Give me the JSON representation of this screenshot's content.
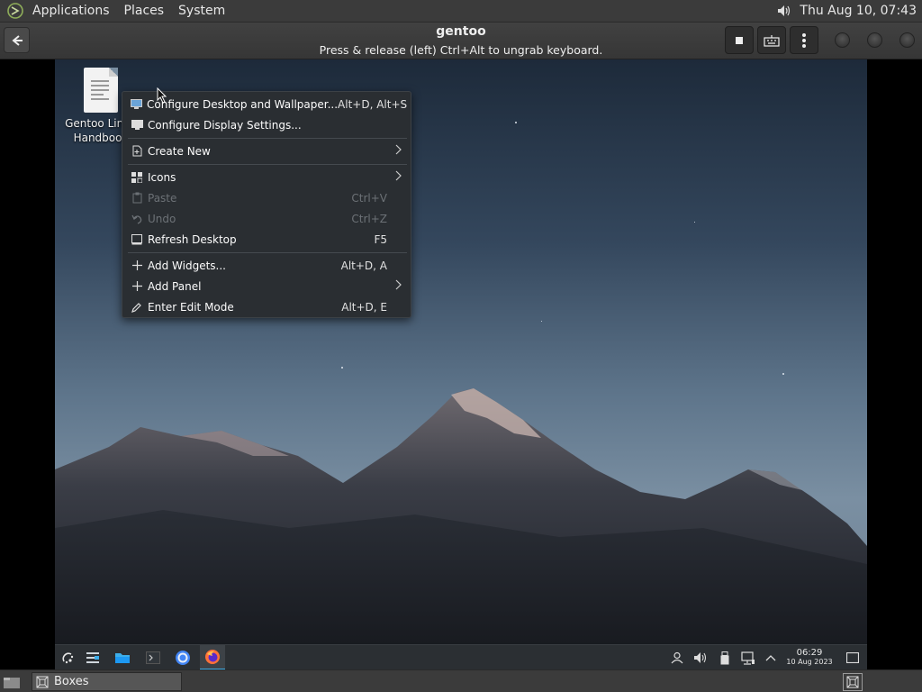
{
  "top_panel": {
    "menus": [
      "Applications",
      "Places",
      "System"
    ],
    "clock": "Thu Aug 10, 07:43"
  },
  "header": {
    "title": "gentoo",
    "subtitle": "Press & release (left) Ctrl+Alt to ungrab keyboard."
  },
  "desktop": {
    "icon_label_line1": "Gentoo Linux",
    "icon_label_line2": "Handbook"
  },
  "context_menu": {
    "items": [
      {
        "label": "Configure Desktop and Wallpaper...",
        "shortcut": "Alt+D, Alt+S",
        "icon": "wallpaper-icon",
        "enabled": true
      },
      {
        "label": "Configure Display Settings...",
        "shortcut": "",
        "icon": "display-icon",
        "enabled": true
      },
      {
        "label": "Create New",
        "shortcut": "",
        "icon": "new-document-icon",
        "enabled": true,
        "submenu": true
      },
      {
        "label": "Icons",
        "shortcut": "",
        "icon": "icons-grid-icon",
        "enabled": true,
        "submenu": true
      },
      {
        "label": "Paste",
        "shortcut": "Ctrl+V",
        "icon": "paste-icon",
        "enabled": false
      },
      {
        "label": "Undo",
        "shortcut": "Ctrl+Z",
        "icon": "undo-icon",
        "enabled": false
      },
      {
        "label": "Refresh Desktop",
        "shortcut": "F5",
        "icon": "refresh-icon",
        "enabled": true
      },
      {
        "label": "Add Widgets...",
        "shortcut": "Alt+D, A",
        "icon": "plus-icon",
        "enabled": true
      },
      {
        "label": "Add Panel",
        "shortcut": "",
        "icon": "plus-icon",
        "enabled": true,
        "submenu": true
      },
      {
        "label": "Enter Edit Mode",
        "shortcut": "Alt+D, E",
        "icon": "pencil-icon",
        "enabled": true
      }
    ]
  },
  "vm_panel": {
    "time": "06:29",
    "date": "10 Aug 2023",
    "accent": "#3daee9"
  },
  "bottom_taskbar": {
    "task_label": "Boxes"
  }
}
